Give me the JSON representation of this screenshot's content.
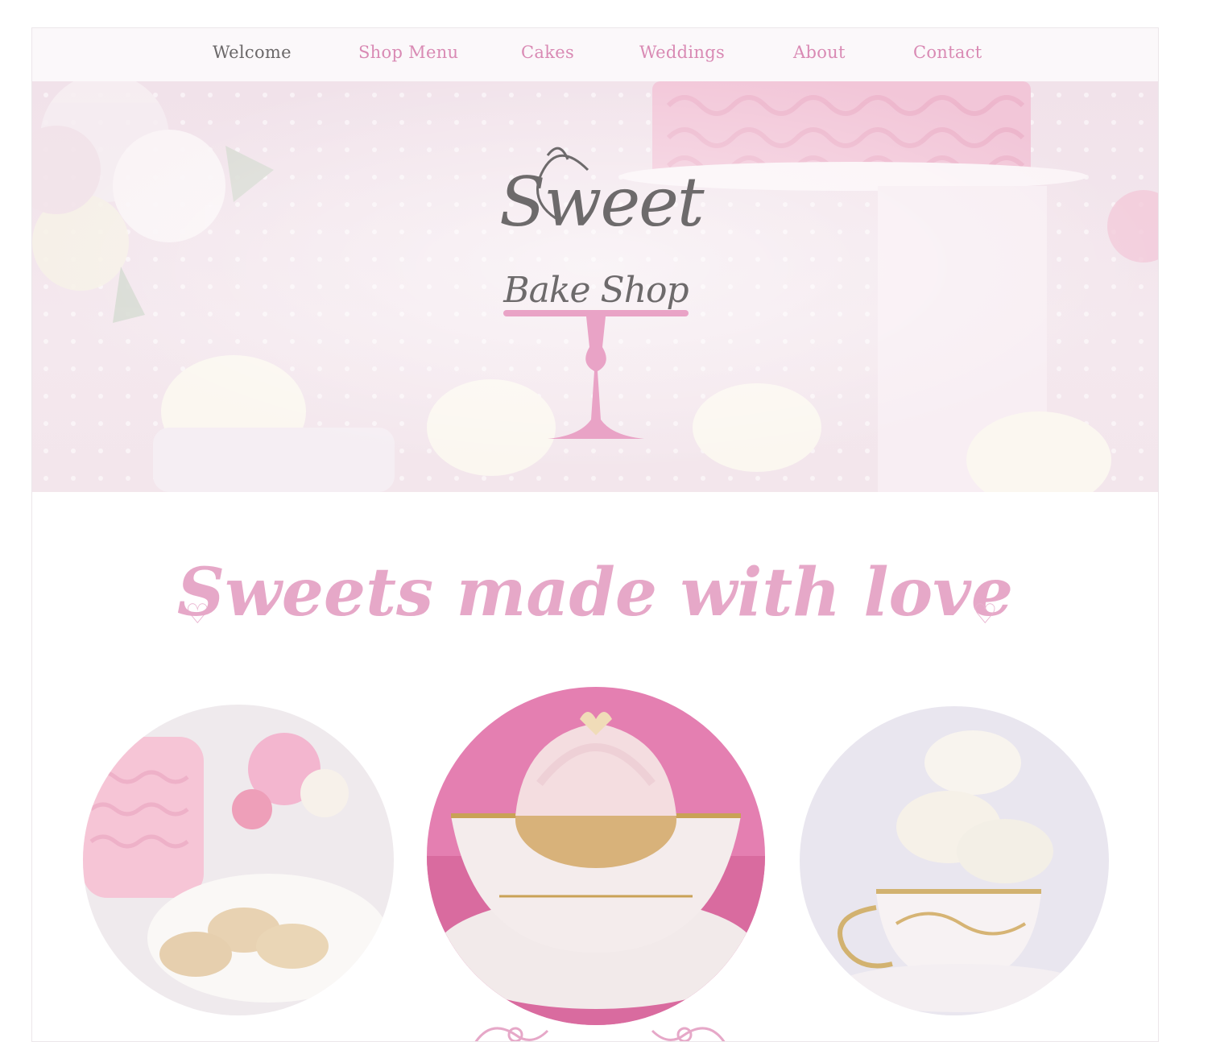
{
  "nav": {
    "items": [
      {
        "label": "Welcome",
        "color": "#6b6869"
      },
      {
        "label": "Shop Menu",
        "color": "#d98ab4"
      },
      {
        "label": "Cakes",
        "color": "#d98ab4"
      },
      {
        "label": "Weddings",
        "color": "#d98ab4"
      },
      {
        "label": "About",
        "color": "#d98ab4"
      },
      {
        "label": "Contact",
        "color": "#d98ab4"
      }
    ]
  },
  "logo": {
    "line1": "Sweet",
    "line2": "Bake Shop"
  },
  "tagline": "Sweets made with love",
  "colors": {
    "accent_pink": "#e6a8c8",
    "logo_gray": "#6d6a6b",
    "stand_pink": "#e9a3c6"
  },
  "gallery": [
    {
      "name": "cake-and-cookies-photo"
    },
    {
      "name": "cupcake-teacup-photo"
    },
    {
      "name": "macarons-teacup-photo"
    }
  ]
}
